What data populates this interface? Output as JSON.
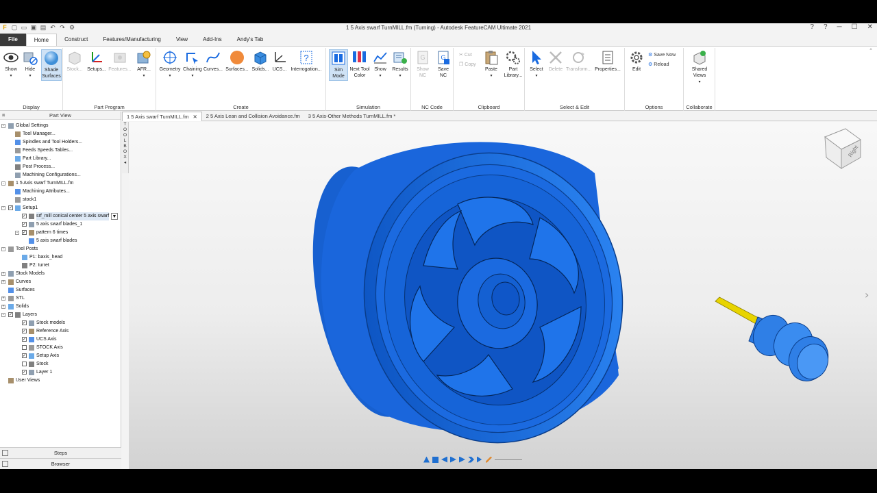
{
  "window": {
    "title": "1 5 Axis swarf TurnMILL.fm (Turning) - Autodesk FeatureCAM Ultimate 2021",
    "controls": [
      "?",
      "?",
      "─",
      "☐",
      "✕"
    ]
  },
  "ribbon_tabs": [
    "File",
    "Home",
    "Construct",
    "Features/Manufacturing",
    "View",
    "Add-Ins",
    "Andy's Tab"
  ],
  "ribbon": {
    "display": {
      "label": "Display",
      "show": "Show",
      "hide": "Hide",
      "shade_surfaces": "Shade\nSurfaces"
    },
    "part_program": {
      "label": "Part Program",
      "stock": "Stock...",
      "setups": "Setups...",
      "features": "Features...",
      "afr": "AFR..."
    },
    "create": {
      "label": "Create",
      "geometry": "Geometry",
      "chaining": "Chaining",
      "curves": "Curves...",
      "surfaces": "Surfaces...",
      "solids": "Solids...",
      "ucs": "UCS...",
      "interrogation": "Interrogation..."
    },
    "simulation": {
      "label": "Simulation",
      "sim_mode": "Sim\nMode",
      "next_tool_color": "Next Tool\nColor",
      "show": "Show",
      "results": "Results"
    },
    "nc_code": {
      "label": "NC Code",
      "show_nc": "Show\nNC",
      "save_nc": "Save\nNC"
    },
    "clipboard": {
      "label": "Clipboard",
      "cut": "Cut",
      "copy": "Copy",
      "paste": "Paste",
      "part_library": "Part\nLibrary..."
    },
    "select_edit": {
      "label": "Select & Edit",
      "select": "Select",
      "delete": "Delete",
      "transform": "Transform...",
      "properties": "Properties..."
    },
    "options": {
      "label": "Options",
      "edit": "Edit",
      "save_now": "Save Now",
      "reload": "Reload"
    },
    "collaborate": {
      "label": "Collaborate",
      "shared_views": "Shared\nViews"
    }
  },
  "part_view": {
    "title": "Part View",
    "tree": [
      {
        "label": "Global Settings",
        "level": 0,
        "exp": "-"
      },
      {
        "label": "Tool Manager...",
        "level": 1
      },
      {
        "label": "Spindles and Tool Holders...",
        "level": 1
      },
      {
        "label": "Feeds  Speeds Tables...",
        "level": 1
      },
      {
        "label": "Part Library...",
        "level": 1
      },
      {
        "label": "Post Process...",
        "level": 1
      },
      {
        "label": "Machining Configurations...",
        "level": 1
      },
      {
        "label": "1 5 Axis swarf TurnMILL.fm",
        "level": 0,
        "exp": "-"
      },
      {
        "label": "Machining Attributes...",
        "level": 1
      },
      {
        "label": "stock1",
        "level": 1
      },
      {
        "label": "Setup1",
        "level": 0,
        "exp": "-",
        "chk": true
      },
      {
        "label": "srf_mill conical center 5 axis swarf",
        "level": 2,
        "chk": true,
        "sel": true
      },
      {
        "label": "5 axis swarf blades_1",
        "level": 2,
        "chk": true
      },
      {
        "label": "pattern 6 times",
        "level": 2,
        "chk": true,
        "exp": "-"
      },
      {
        "label": "5 axis swarf blades",
        "level": 3
      },
      {
        "label": "Tool Posts",
        "level": 0,
        "exp": "-"
      },
      {
        "label": "P1: baxis_head",
        "level": 2
      },
      {
        "label": "P2: turret",
        "level": 2
      },
      {
        "label": "Stock Models",
        "level": 0,
        "exp": "+"
      },
      {
        "label": "Curves",
        "level": 0,
        "exp": "+"
      },
      {
        "label": "Surfaces",
        "level": 0
      },
      {
        "label": "STL",
        "level": 0,
        "exp": "+"
      },
      {
        "label": "Solids",
        "level": 0,
        "exp": "+"
      },
      {
        "label": "Layers",
        "level": 0,
        "exp": "-",
        "chk": true
      },
      {
        "label": "Stock models",
        "level": 2,
        "chk": true
      },
      {
        "label": "Reference Axis",
        "level": 2,
        "chk": true
      },
      {
        "label": "UCS Axis",
        "level": 2,
        "chk": true
      },
      {
        "label": "STOCK Axis",
        "level": 2,
        "chk": false
      },
      {
        "label": "Setup Axis",
        "level": 2,
        "chk": true
      },
      {
        "label": "Stock",
        "level": 2,
        "chk": false
      },
      {
        "label": "Layer 1",
        "level": 2,
        "chk": true
      },
      {
        "label": "User Views",
        "level": 0
      }
    ],
    "bottom_tabs": [
      "Steps",
      "Browser"
    ]
  },
  "doc_tabs": [
    "1 5 Axis swarf TurnMILL.fm",
    "2 5 Axis Lean and Collision Avoidance.fm",
    "3 5 Axis-Other Methods TurnMILL.fm *"
  ],
  "side_strips": {
    "toolbox": "TOOLBOX",
    "results": "RESULTS"
  },
  "viewcube": {
    "face": "Right"
  },
  "colors": {
    "part_blue": "#1a6be0",
    "tool_yellow": "#e8d400",
    "ribbon_bg": "#ffffff",
    "file_tab": "#3a3a3a"
  }
}
